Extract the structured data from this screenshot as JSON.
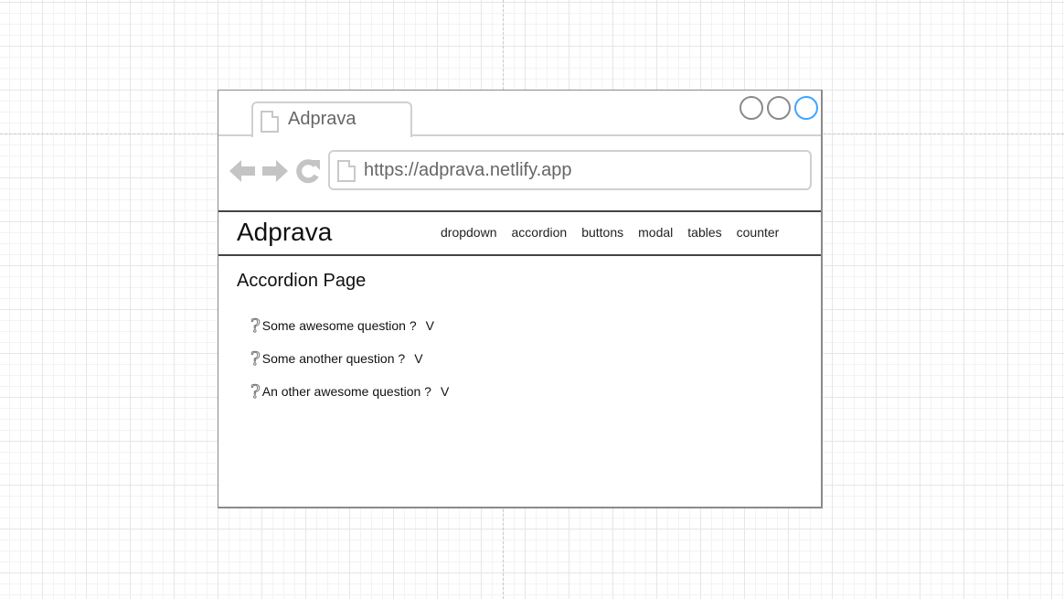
{
  "browser": {
    "tab_title": "Adprava",
    "url": "https://adprava.netlify.app",
    "window_controls": [
      "minimize-circle",
      "maximize-circle",
      "close-circle"
    ],
    "accent_color": "#3ea6ff"
  },
  "site": {
    "logo": "Adprava",
    "nav": [
      "dropdown",
      "accordion",
      "buttons",
      "modal",
      "tables",
      "counter"
    ]
  },
  "page": {
    "heading": "Accordion Page",
    "questions": [
      {
        "text": "Some awesome question ?",
        "toggle": "V"
      },
      {
        "text": "Some another question ?",
        "toggle": "V"
      },
      {
        "text": "An other awesome question ?",
        "toggle": "V"
      }
    ]
  }
}
